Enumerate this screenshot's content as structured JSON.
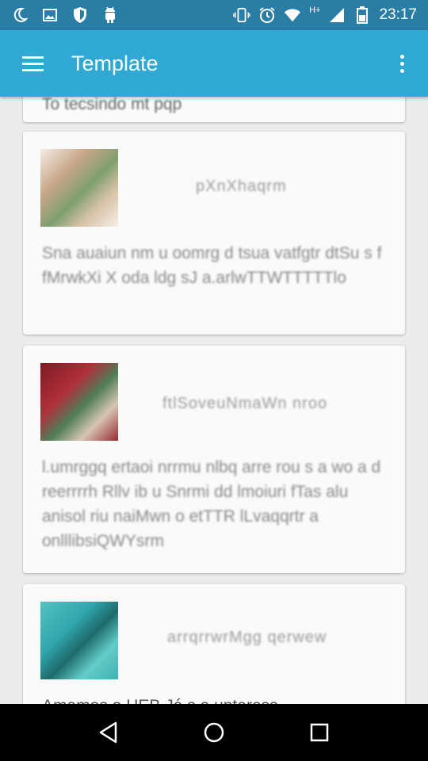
{
  "status_bar": {
    "time": "23:17",
    "network_type": "H+",
    "icons": [
      "moon-icon",
      "image-icon",
      "shield-icon",
      "android-icon",
      "vibrate-icon",
      "alarm-icon",
      "wifi-icon",
      "signal-icon",
      "battery-icon"
    ]
  },
  "app_bar": {
    "title": "Template",
    "menu_icon": "hamburger-icon",
    "overflow_icon": "more-vert-icon"
  },
  "feed": {
    "partial_post_text": "To tecsindo mt pqp",
    "posts": [
      {
        "username": "pXnXhaqrm",
        "text": "Sna auaiun nm u oomrg d tsua vatfgtr dtSu s f fMrwkXi X oda ldg sJ a.arlwTTWTTTTTlo"
      },
      {
        "username": "ftlSoveuNmaWn nroo",
        "text": "l.umrggq ertaoi nrrmu nlbq arre rou s a wo a d reerrrrh Rllv ib u Snrmi dd lmoiuri fTas alu anisol riu naiMwn o etTTR lLvaqqrtr a onlllibsiQWYsrm"
      },
      {
        "username": "arrqrrwrMgg qerwew",
        "text": "Amamos o HEB Já s e unteress"
      }
    ]
  },
  "colors": {
    "status_bar": "#2a7ea6",
    "app_bar": "#2fa8d3",
    "card_background": "#fafafa",
    "page_background": "#ececec",
    "nav_bar": "#000000"
  },
  "nav_bar": {
    "icons": [
      "back-icon",
      "home-icon",
      "recents-icon"
    ]
  }
}
